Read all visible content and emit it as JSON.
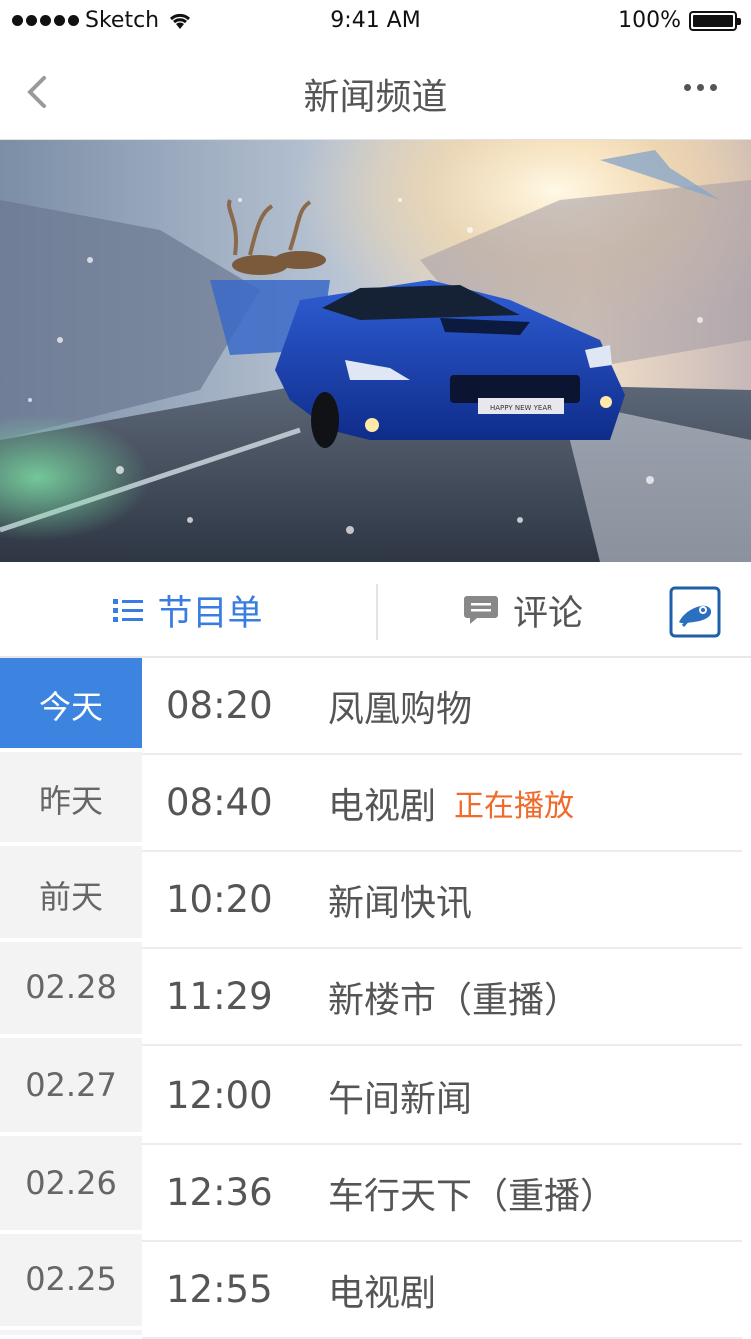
{
  "status_bar": {
    "carrier": "Sketch",
    "time": "9:41 AM",
    "battery": "100%"
  },
  "nav": {
    "title": "新闻频道"
  },
  "tabs": {
    "schedule_label": "节目单",
    "comments_label": "评论"
  },
  "dates": [
    {
      "label": "今天",
      "active": true
    },
    {
      "label": "昨天",
      "active": false
    },
    {
      "label": "前天",
      "active": false
    },
    {
      "label": "02.28",
      "active": false
    },
    {
      "label": "02.27",
      "active": false
    },
    {
      "label": "02.26",
      "active": false
    },
    {
      "label": "02.25",
      "active": false
    }
  ],
  "programs": [
    {
      "time": "08:20",
      "name": "凤凰购物",
      "badge": ""
    },
    {
      "time": "08:40",
      "name": "电视剧",
      "badge": "正在播放"
    },
    {
      "time": "10:20",
      "name": "新闻快讯",
      "badge": ""
    },
    {
      "time": "11:29",
      "name": "新楼市（重播）",
      "badge": ""
    },
    {
      "time": "12:00",
      "name": "午间新闻",
      "badge": ""
    },
    {
      "time": "12:36",
      "name": "车行天下（重播）",
      "badge": ""
    },
    {
      "time": "12:55",
      "name": "电视剧",
      "badge": ""
    }
  ],
  "banner": {
    "plate_text": "HAPPY NEW YEAR"
  },
  "colors": {
    "accent": "#3d84e0",
    "live": "#f06a2a"
  }
}
